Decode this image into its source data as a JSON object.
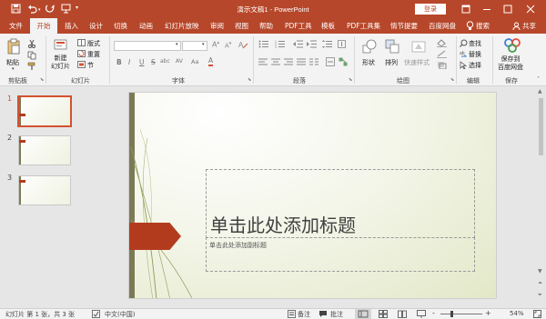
{
  "titlebar": {
    "title": "演示文稿1  -  PowerPoint",
    "login_label": "登录"
  },
  "tabs": [
    {
      "label": "文件"
    },
    {
      "label": "开始"
    },
    {
      "label": "插入"
    },
    {
      "label": "设计"
    },
    {
      "label": "切换"
    },
    {
      "label": "动画"
    },
    {
      "label": "幻灯片放映"
    },
    {
      "label": "审阅"
    },
    {
      "label": "视图"
    },
    {
      "label": "帮助"
    },
    {
      "label": "PDF工具"
    },
    {
      "label": "模板"
    },
    {
      "label": "PDF工具集"
    },
    {
      "label": "情节提要"
    },
    {
      "label": "百度网盘"
    },
    {
      "label": "搜索"
    }
  ],
  "share_label": "共享",
  "ribbon": {
    "clipboard": {
      "paste_label": "粘贴",
      "group_label": "剪贴板"
    },
    "slides": {
      "new_slide_label": "新建\n幻灯片",
      "layout_label": "版式",
      "reset_label": "重置",
      "section_label": "节",
      "group_label": "幻灯片"
    },
    "font": {
      "group_label": "字体",
      "bold": "B",
      "italic": "I",
      "underline": "U",
      "strike": "S",
      "shadow": "abc",
      "spacing": "AV",
      "case": "Aa",
      "color": "A"
    },
    "paragraph": {
      "group_label": "段落"
    },
    "drawing": {
      "shape_label": "形状",
      "arrange_label": "排列",
      "quick_style_label": "快速样式",
      "group_label": "绘图"
    },
    "editing": {
      "find_label": "查找",
      "replace_label": "替换",
      "select_label": "选择",
      "group_label": "编辑"
    },
    "save": {
      "save_label": "保存到\n百度网盘",
      "group_label": "保存"
    }
  },
  "thumbnails": [
    {
      "number": "1"
    },
    {
      "number": "2"
    },
    {
      "number": "3"
    }
  ],
  "slide": {
    "title_placeholder": "单击此处添加标题",
    "subtitle_placeholder": "单击此处添加副标题"
  },
  "status": {
    "slide_info": "幻灯片 第 1 张，共 3 张",
    "language": "中文(中国)",
    "notes_label": "备注",
    "comments_label": "批注",
    "zoom_minus": "-",
    "zoom_plus": "+",
    "zoom": "54%",
    "zoom_level": 0.54
  },
  "colors": {
    "accent": "#b7472a",
    "slide_arrow": "#b33b1d",
    "slide_bar": "#7c7a56",
    "slide_bg_light": "#ffffff",
    "slide_bg_dark": "#e3e8c8"
  },
  "icons": [
    "save-icon",
    "undo-icon",
    "redo-icon",
    "present-icon",
    "customize-icon",
    "restore-icon",
    "minimize-icon",
    "maximize-icon",
    "close-icon",
    "lightbulb-icon",
    "share-icon",
    "cut-icon",
    "copy-icon",
    "format-painter-icon",
    "notes-icon",
    "comments-icon",
    "normal-view-icon",
    "sorter-view-icon",
    "reading-view-icon",
    "slideshow-view-icon",
    "fit-icon"
  ]
}
